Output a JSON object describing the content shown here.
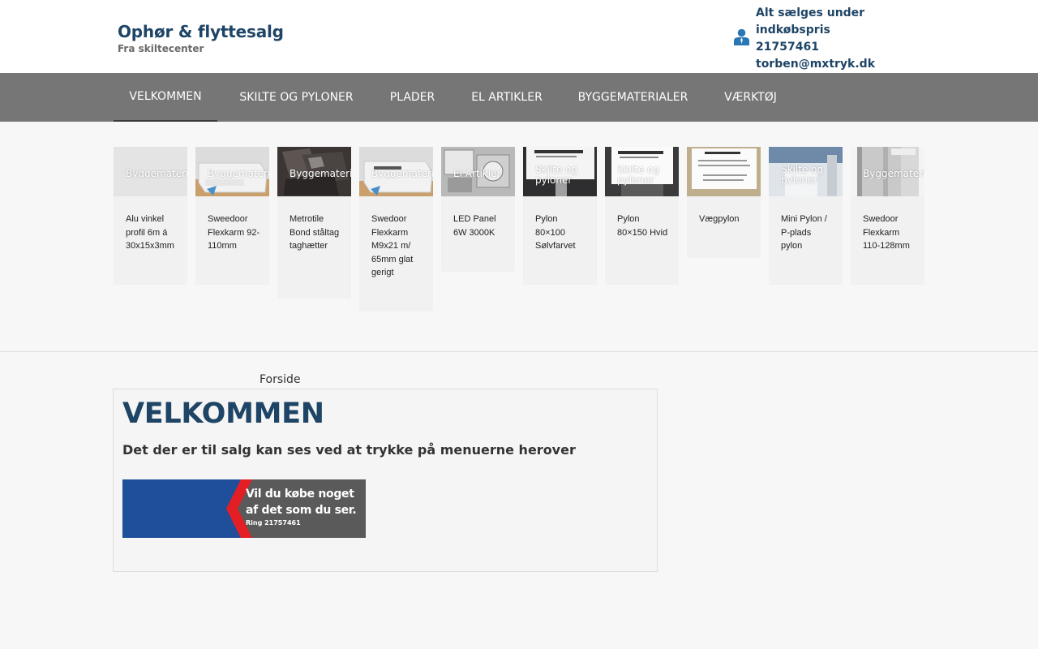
{
  "header": {
    "title": "Ophør & flyttesalg",
    "subtitle": "Fra skiltecenter",
    "contact_icon": "user-icon",
    "contact_lines": [
      "Alt sælges under",
      "indkøbspris",
      "21757461",
      "torben@mxtryk.dk"
    ]
  },
  "nav": {
    "items": [
      "VELKOMMEN",
      "SKILTE OG PYLONER",
      "PLADER",
      "EL ARTIKLER",
      "BYGGEMATERIALER",
      "VÆRKTØJ"
    ],
    "active": "VELKOMMEN"
  },
  "products": [
    {
      "category": "Byggematerialer",
      "name": "Alu vinkel profil 6m á 30x15x3mm"
    },
    {
      "category": "Byggematerialer",
      "name": "Sweedoor Flexkarm 92-110mm"
    },
    {
      "category": "Byggematerialer",
      "name": "Metrotile Bond ståltag taghætter"
    },
    {
      "category": "Byggematerialer",
      "name": "Swedoor Flexkarm M9x21 m/ 65mm glat gerigt"
    },
    {
      "category": "El Artikler",
      "name": "LED Panel 6W 3000K"
    },
    {
      "category": "Skilte og pyloner",
      "name": "Pylon 80×100 Sølvfarvet"
    },
    {
      "category": "Skilte og pyloner",
      "name": "Pylon 80×150 Hvid"
    },
    {
      "category": "",
      "name": "Vægpylon"
    },
    {
      "category": "Skilte og pyloner",
      "name": "Mini Pylon / P-plads pylon"
    },
    {
      "category": "Byggematerialer",
      "name": "Swedoor Flexkarm 110-128mm"
    }
  ],
  "breadcrumb": "Forside",
  "content": {
    "heading": "VELKOMMEN",
    "intro": "Det der er til salg kan ses ved at trykke på menuerne herover",
    "banner": {
      "line1": "Vil du købe noget",
      "line2": "af det som du ser.",
      "line3": "Ring 21757461",
      "colors": {
        "left": "#1f4e9a",
        "stripe": "#e31e24",
        "right": "#5a5a5a"
      }
    }
  },
  "colors": {
    "brand": "#1e4466",
    "nav": "#767676",
    "background": "#f7f7f7"
  }
}
